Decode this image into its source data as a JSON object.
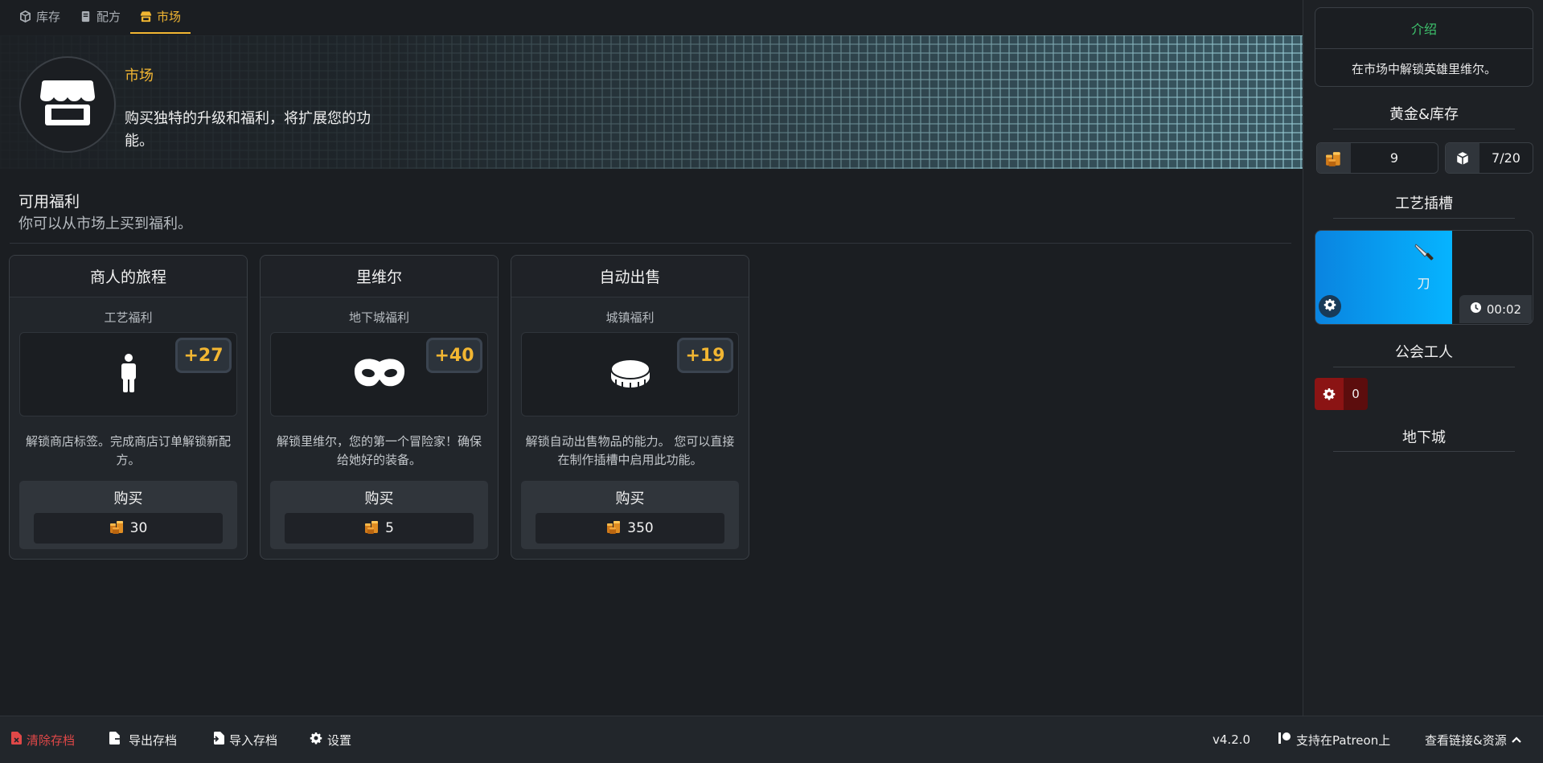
{
  "nav": {
    "tabs": [
      {
        "label": "库存",
        "icon": "box-icon"
      },
      {
        "label": "配方",
        "icon": "book-icon"
      },
      {
        "label": "市场",
        "icon": "store-icon",
        "active": true
      }
    ]
  },
  "banner": {
    "title": "市场",
    "description": "购买独特的升级和福利，将扩展您的功能。"
  },
  "section": {
    "title": "可用福利",
    "subtitle": "你可以从市场上买到福利。"
  },
  "perks": [
    {
      "name": "商人的旅程",
      "type": "工艺福利",
      "icon": "person-icon",
      "bonus": "+27",
      "description": "解锁商店标签。完成商店订单解锁新配方。",
      "buy_label": "购买",
      "price": "30"
    },
    {
      "name": "里维尔",
      "type": "地下城福利",
      "icon": "mask-icon",
      "bonus": "+40",
      "description": "解锁里维尔，您的第一个冒险家！确保给她好的装备。",
      "buy_label": "购买",
      "price": "5"
    },
    {
      "name": "自动出售",
      "type": "城镇福利",
      "icon": "coin-icon",
      "bonus": "+19",
      "description": "解锁自动出售物品的能力。 您可以直接在制作插槽中启用此功能。",
      "buy_label": "购买",
      "price": "350"
    }
  ],
  "sidebar": {
    "intro": {
      "title": "介绍",
      "body": "在市场中解锁英雄里维尔。"
    },
    "gold_inventory": {
      "title": "黄金&库存",
      "gold": "9",
      "inventory": "7/20"
    },
    "craft_slots": {
      "title": "工艺插槽",
      "item_name": "刀",
      "item_icon": "knife-icon",
      "timer": "00:02",
      "progress": 0.63
    },
    "guild_workers": {
      "title": "公会工人",
      "count": "0"
    },
    "dungeon": {
      "title": "地下城"
    }
  },
  "footer": {
    "clear_save": "清除存档",
    "export_save": "导出存档",
    "import_save": "导入存档",
    "settings": "设置",
    "version": "v4.2.0",
    "patreon": "支持在Patreon上",
    "links": "查看链接&资源"
  },
  "colors": {
    "accent": "#f2b632",
    "intro_green": "#3ec46d",
    "danger": "#e04848",
    "craft_blue": "#06b4ff",
    "worker_red": "#8b1414"
  }
}
